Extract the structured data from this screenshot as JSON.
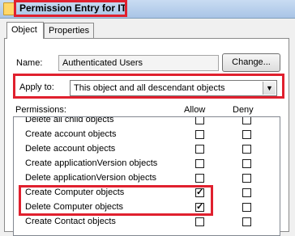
{
  "window": {
    "title": "Permission Entry for IT",
    "icon": "folder-icon"
  },
  "tabs": [
    {
      "label": "Object",
      "active": true
    },
    {
      "label": "Properties",
      "active": false
    }
  ],
  "name_field": {
    "label": "Name:",
    "value": "Authenticated Users",
    "button_label": "Change..."
  },
  "apply_to": {
    "label": "Apply to:",
    "value": "This object and all descendant objects"
  },
  "permissions": {
    "label": "Permissions:",
    "allow_header": "Allow",
    "deny_header": "Deny",
    "rows": [
      {
        "label": "Delete all child objects",
        "allow": false,
        "deny": false
      },
      {
        "label": "Create account objects",
        "allow": false,
        "deny": false
      },
      {
        "label": "Delete account objects",
        "allow": false,
        "deny": false
      },
      {
        "label": "Create applicationVersion objects",
        "allow": false,
        "deny": false
      },
      {
        "label": "Delete applicationVersion objects",
        "allow": false,
        "deny": false
      },
      {
        "label": "Create Computer objects",
        "allow": true,
        "deny": false
      },
      {
        "label": "Delete Computer objects",
        "allow": true,
        "deny": false
      },
      {
        "label": "Create Contact objects",
        "allow": false,
        "deny": false
      }
    ]
  },
  "colors": {
    "highlight": "#e0202e",
    "title_gradient": [
      "#c9dcf2",
      "#a9c4e6"
    ]
  }
}
